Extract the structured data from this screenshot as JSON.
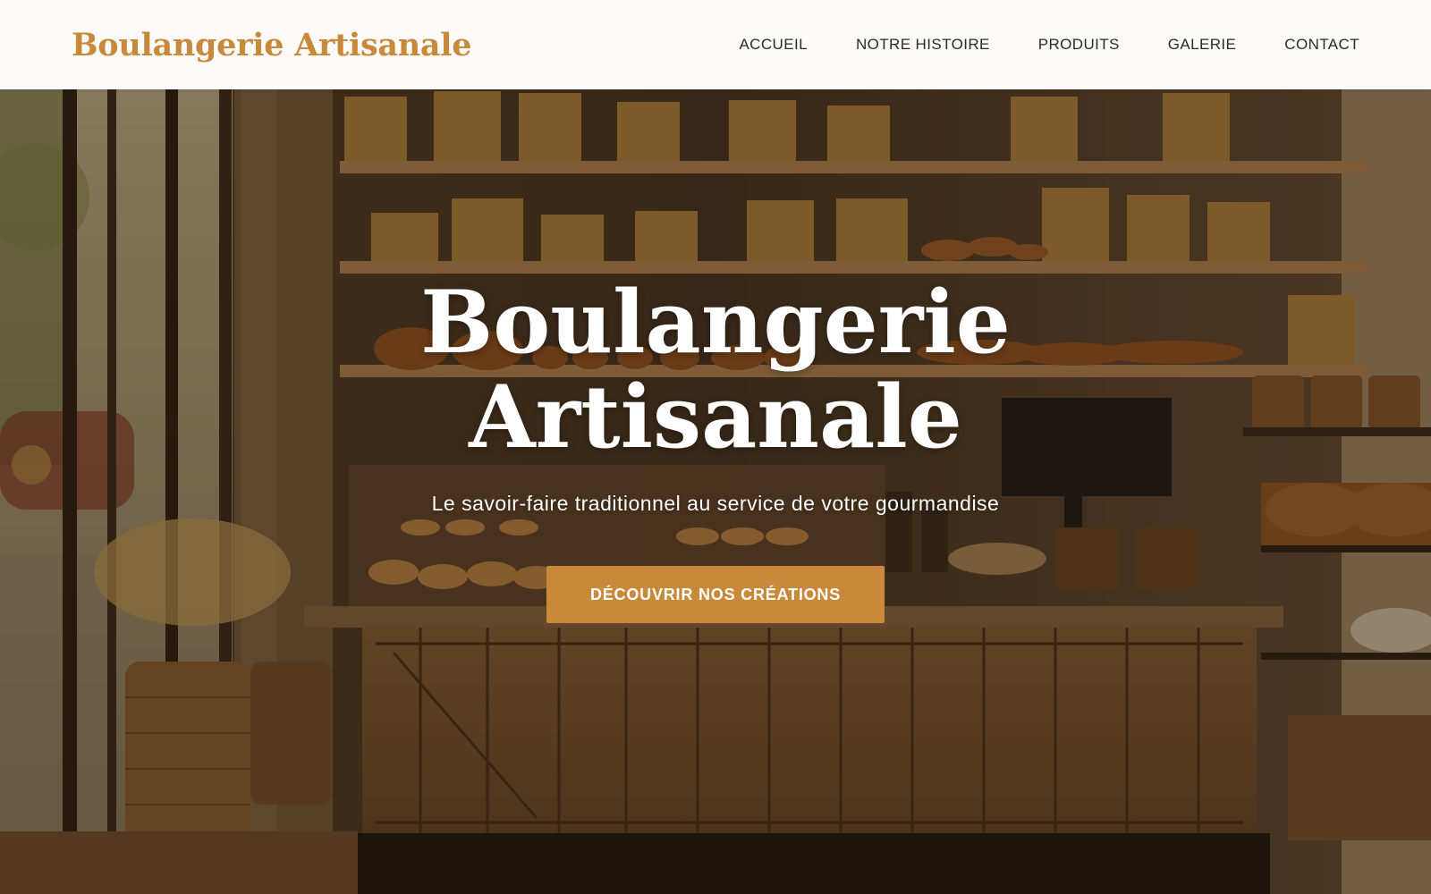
{
  "brand": {
    "name": "Boulangerie Artisanale",
    "accent_color": "#c8893a"
  },
  "nav": {
    "items": [
      {
        "label": "ACCUEIL"
      },
      {
        "label": "NOTRE HISTOIRE"
      },
      {
        "label": "PRODUITS"
      },
      {
        "label": "GALERIE"
      },
      {
        "label": "CONTACT"
      }
    ]
  },
  "hero": {
    "title": "Boulangerie Artisanale",
    "subtitle": "Le savoir-faire traditionnel au service de votre gourmandise",
    "cta_label": "DÉCOUVRIR NOS CRÉATIONS",
    "background_image": "bakery-interior-photo"
  }
}
